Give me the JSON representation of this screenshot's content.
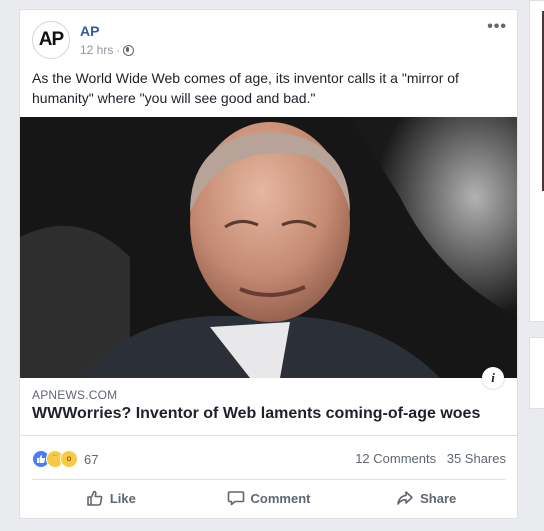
{
  "post": {
    "page_name": "AP",
    "avatar_text": "AP",
    "timestamp": "12 hrs",
    "separator": "·",
    "privacy_icon": "globe-icon",
    "more_icon": "•••",
    "text": "As the World Wide Web comes of age, its inventor calls it a \"mirror of humanity\" where \"you will see good and bad.\""
  },
  "link": {
    "domain": "APNEWS.COM",
    "title": "WWWorries? Inventor of Web laments coming-of-age woes",
    "info_icon": "i"
  },
  "stats": {
    "reactions": [
      "like",
      "sad",
      "wow"
    ],
    "reaction_count": "67",
    "comments": "12 Comments",
    "shares": "35 Shares"
  },
  "actions": {
    "like": "Like",
    "comment": "Comment",
    "share": "Share"
  },
  "colors": {
    "link_blue": "#365899",
    "text": "#1d2129",
    "muted": "#606770",
    "like_blue": "#4c7cf7",
    "emoji_yellow": "#f7c944"
  }
}
